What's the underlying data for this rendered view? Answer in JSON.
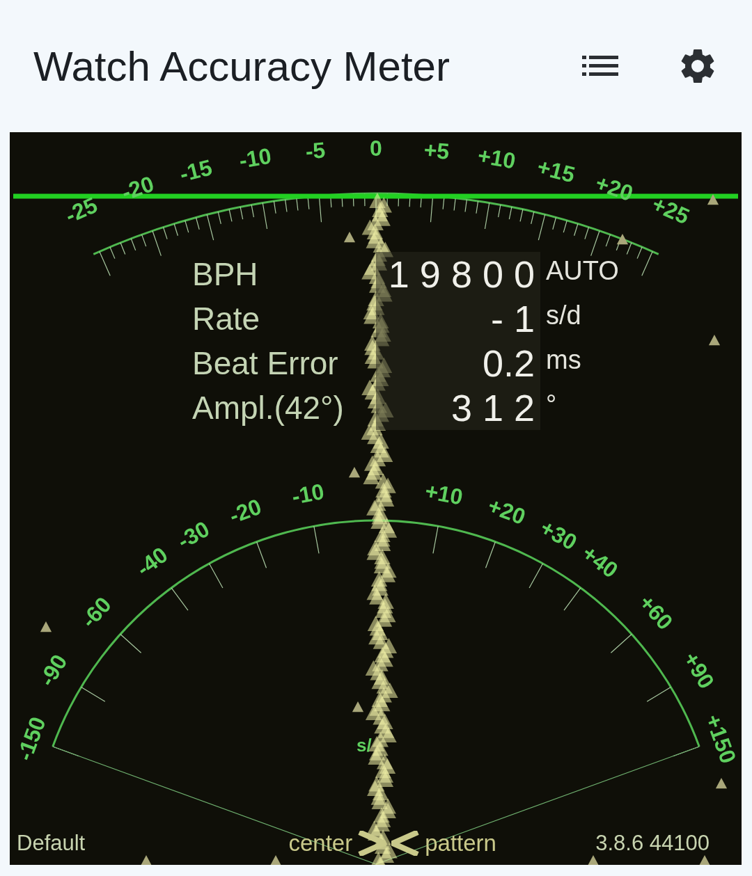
{
  "app_bar": {
    "title": "Watch Accuracy Meter"
  },
  "rate_scale": {
    "labels": [
      "-25",
      "-20",
      "-15",
      "-10",
      "-5",
      "0",
      "+5",
      "+10",
      "+15",
      "+20",
      "+25"
    ]
  },
  "amplitude_scale": {
    "labels": [
      "-150",
      "-90",
      "-60",
      "-40",
      "-30",
      "-20",
      "-10",
      "+10",
      "+20",
      "+30",
      "+40",
      "+60",
      "+90",
      "+150"
    ]
  },
  "readings": [
    {
      "label": "BPH",
      "value": "1 9 8 0 0",
      "unit": "AUTO"
    },
    {
      "label": "Rate",
      "value": "- 1",
      "unit": "s/d"
    },
    {
      "label": "Beat Error",
      "value": "0.2",
      "unit": "ms"
    },
    {
      "label": "Ampl.(42°)",
      "value": "3 1 2",
      "unit": "°"
    }
  ],
  "trace_unit": "s/",
  "footer": {
    "profile": "Default",
    "left_hint": "center",
    "right_hint": "pattern",
    "version": "3.8.6 44100"
  }
}
